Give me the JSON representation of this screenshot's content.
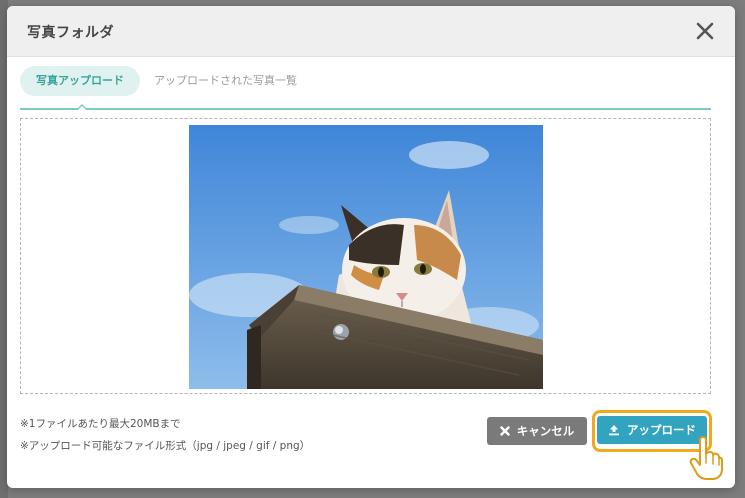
{
  "modal": {
    "title": "写真フォルダ"
  },
  "tabs": [
    {
      "label": "写真アップロード",
      "active": true
    },
    {
      "label": "アップロードされた写真一覧",
      "active": false
    }
  ],
  "notes": [
    "※1ファイルあたり最大20MBまで",
    "※アップロード可能なファイル形式（jpg / jpeg / gif / png）"
  ],
  "buttons": {
    "cancel_label": "キャンセル",
    "upload_label": "アップロード"
  },
  "colors": {
    "accent_teal": "#3aa39c",
    "upload_blue": "#33a4bf",
    "highlight_orange": "#f2a81d",
    "cancel_gray": "#7a7a7a"
  },
  "icons": {
    "close": "close-icon",
    "cancel": "x-icon",
    "upload": "upload-icon",
    "cursor": "hand-pointer-icon"
  }
}
